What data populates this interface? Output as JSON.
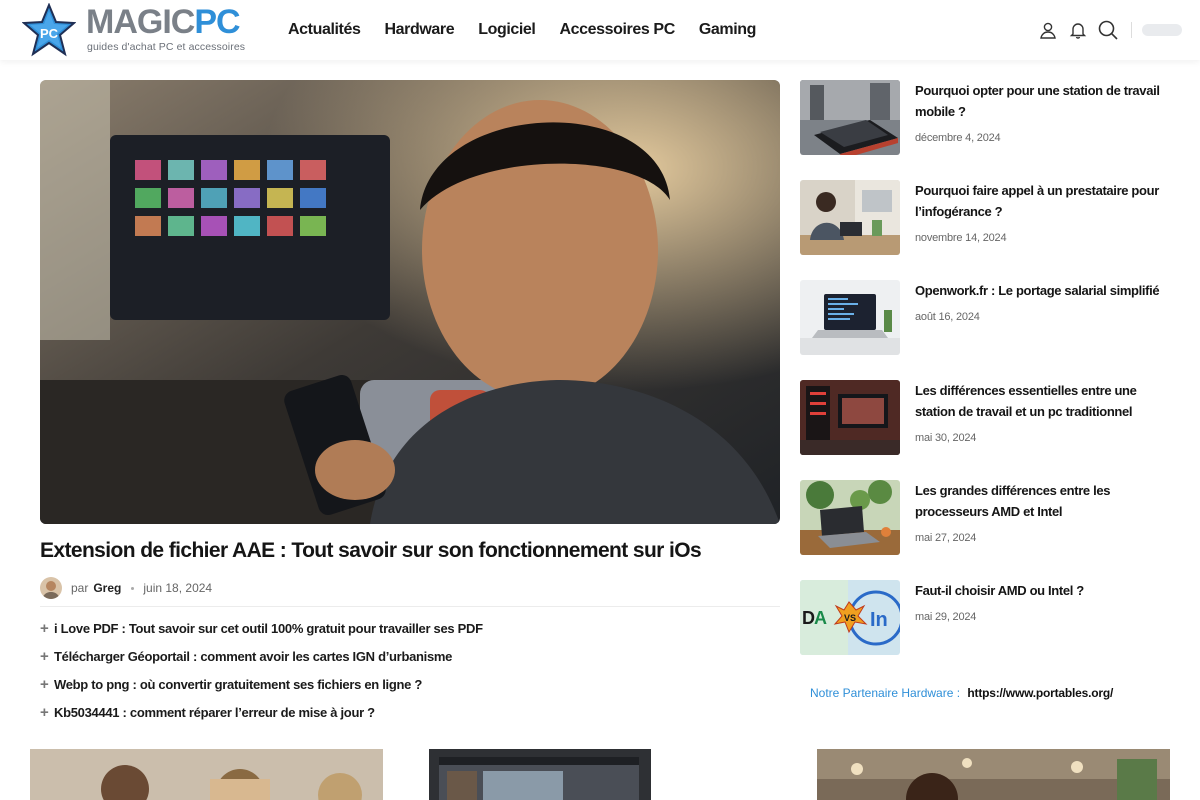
{
  "site": {
    "logo_word_a": "MAGIC",
    "logo_word_b": "PC",
    "logo_star_text": "PC",
    "tagline": "guides d'achat PC et accessoires"
  },
  "nav": {
    "items": [
      "Actualités",
      "Hardware",
      "Logiciel",
      "Accessoires PC",
      "Gaming"
    ]
  },
  "header_icons": [
    "user-icon",
    "bell-icon",
    "search-icon"
  ],
  "featured": {
    "title": "Extension de fichier AAE : Tout savoir sur son fonctionnement sur iOs",
    "by_label": "par",
    "author": "Greg",
    "date": "juin 18, 2024",
    "related": [
      "i Love PDF : Tout savoir sur cet outil 100% gratuit pour travailler ses PDF",
      "Télécharger Géoportail : comment avoir les cartes IGN d’urbanisme",
      "Webp to png : où convertir gratuitement ses fichiers en ligne ?",
      "Kb5034441 : comment réparer l’erreur de mise à jour ?"
    ]
  },
  "sidebar": {
    "posts": [
      {
        "title": "Pourquoi opter pour une station de travail mobile ?",
        "date": "décembre 4, 2024"
      },
      {
        "title": "Pourquoi faire appel à un prestataire pour l’infogérance ?",
        "date": "novembre 14, 2024"
      },
      {
        "title": "Openwork.fr : Le portage salarial simplifié",
        "date": "août 16, 2024"
      },
      {
        "title": "Les différences essentielles entre une station de travail et un pc traditionnel",
        "date": "mai 30, 2024"
      },
      {
        "title": "Les grandes différences entre les processeurs AMD et Intel",
        "date": "mai 27, 2024"
      },
      {
        "title": "Faut-il choisir AMD ou Intel ?",
        "date": "mai 29, 2024"
      }
    ],
    "partner_label": "Notre Partenaire Hardware :",
    "partner_link": "https://www.portables.org/"
  },
  "colors": {
    "accent": "#2f8fd8",
    "text": "#151515",
    "muted": "#666666"
  }
}
